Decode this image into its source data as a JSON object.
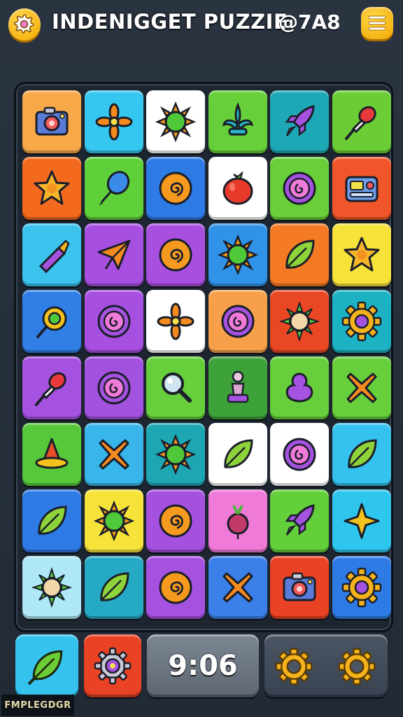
{
  "header": {
    "title": "INDENIGGET PUZZIE",
    "score": "@7A8",
    "settings_icon": "gear-icon",
    "menu_icon": "hamburger-menu-icon"
  },
  "board": {
    "columns": 6,
    "rows": 8,
    "tiles": [
      {
        "color": "#f7a94a",
        "icon": "camera-icon"
      },
      {
        "color": "#35c7ef",
        "icon": "propeller-icon"
      },
      {
        "color": "#ffffff",
        "icon": "sun-icon"
      },
      {
        "color": "#67cf3a",
        "icon": "fleur-icon"
      },
      {
        "color": "#1ea8b5",
        "icon": "rocket-icon"
      },
      {
        "color": "#6ccc35",
        "icon": "pushpin-icon"
      },
      {
        "color": "#f36a1f",
        "icon": "star-icon"
      },
      {
        "color": "#5fd03a",
        "icon": "balloon-icon"
      },
      {
        "color": "#2f7be6",
        "icon": "spiral-icon"
      },
      {
        "color": "#ffffff",
        "icon": "tomato-icon"
      },
      {
        "color": "#69cf39",
        "icon": "swirl-icon"
      },
      {
        "color": "#f0562a",
        "icon": "radio-icon"
      },
      {
        "color": "#3bc3ee",
        "icon": "crayon-icon"
      },
      {
        "color": "#a74fe0",
        "icon": "paper-plane-icon"
      },
      {
        "color": "#a84fe0",
        "icon": "spiral-icon"
      },
      {
        "color": "#3093e8",
        "icon": "sun-icon"
      },
      {
        "color": "#f47a24",
        "icon": "leaf-icon"
      },
      {
        "color": "#f7e23a",
        "icon": "star-icon"
      },
      {
        "color": "#2f7fe6",
        "icon": "lollipop-icon"
      },
      {
        "color": "#a64fe0",
        "icon": "swirl-icon"
      },
      {
        "color": "#ffffff",
        "icon": "propeller-icon"
      },
      {
        "color": "#f6a14a",
        "icon": "swirl-icon"
      },
      {
        "color": "#ea4724",
        "icon": "spiky-ball-icon"
      },
      {
        "color": "#1db2c3",
        "icon": "gear-icon"
      },
      {
        "color": "#a452df",
        "icon": "pushpin-icon"
      },
      {
        "color": "#a351df",
        "icon": "swirl-icon"
      },
      {
        "color": "#66cf3b",
        "icon": "magnifier-icon"
      },
      {
        "color": "#3ea23a",
        "icon": "chess-piece-icon"
      },
      {
        "color": "#66cf3b",
        "icon": "blob-icon"
      },
      {
        "color": "#66cf3b",
        "icon": "cross-icon"
      },
      {
        "color": "#56c83a",
        "icon": "witch-hat-icon"
      },
      {
        "color": "#38b6ea",
        "icon": "cross-icon"
      },
      {
        "color": "#1ea6b3",
        "icon": "sun-icon"
      },
      {
        "color": "#ffffff",
        "icon": "leaf-icon"
      },
      {
        "color": "#ffffff",
        "icon": "swirl-icon"
      },
      {
        "color": "#35c2ee",
        "icon": "leaf-icon"
      },
      {
        "color": "#2f7be6",
        "icon": "leaf-icon"
      },
      {
        "color": "#f7e23a",
        "icon": "sun-icon"
      },
      {
        "color": "#a451df",
        "icon": "spiral-icon"
      },
      {
        "color": "#f07ad8",
        "icon": "radish-icon"
      },
      {
        "color": "#63cf3a",
        "icon": "rocket-icon"
      },
      {
        "color": "#2fc6ee",
        "icon": "sparkle-icon"
      },
      {
        "color": "#aee8f6",
        "icon": "spiky-ball-icon"
      },
      {
        "color": "#26a9c4",
        "icon": "leaf-icon"
      },
      {
        "color": "#a652e0",
        "icon": "spiral-icon"
      },
      {
        "color": "#3b7fe8",
        "icon": "cross-icon"
      },
      {
        "color": "#ea4224",
        "icon": "camera-icon"
      },
      {
        "color": "#2f7be6",
        "icon": "gear-icon"
      }
    ]
  },
  "footer": {
    "hint_icon": "leaf-icon",
    "hint_color": "#35c2ee",
    "power_icon": "gear-icon",
    "power_color": "#ea4224",
    "timer": "9:06",
    "options_icons": [
      "gear-icon",
      "gear-icon"
    ],
    "corner_label": "FMPLEGDGR"
  }
}
